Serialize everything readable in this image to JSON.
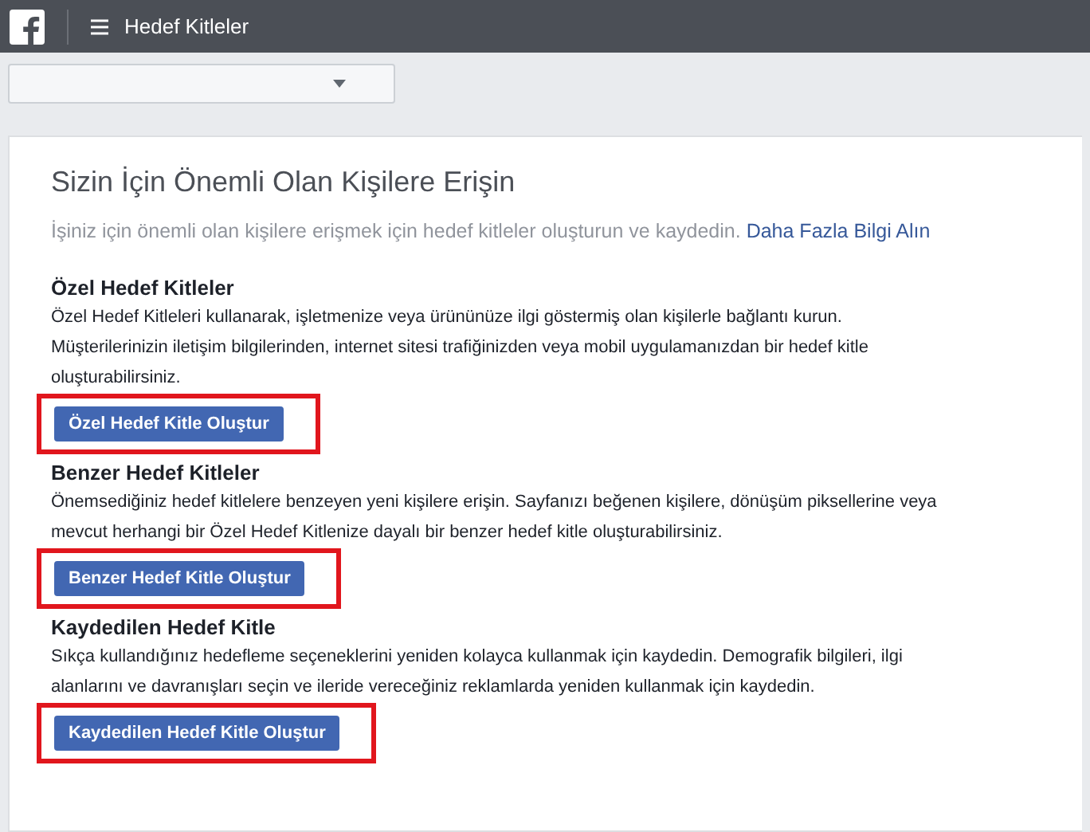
{
  "top_bar": {
    "title": "Hedef Kitleler"
  },
  "account_selector": {
    "expanded": false
  },
  "intro": {
    "heading": "Sizin İçin Önemli Olan Kişilere Erişin",
    "text": "İşiniz için önemli olan kişilere erişmek için hedef kitleler oluşturun ve kaydedin.",
    "link": "Daha Fazla Bilgi Alın"
  },
  "sections": [
    {
      "title": "Özel Hedef Kitleler",
      "description": "Özel Hedef Kitleleri kullanarak, işletmenize veya ürününüze ilgi göstermiş olan kişilerle bağlantı kurun. Müşterilerinizin iletişim bilgilerinden, internet sitesi trafiğinizden veya mobil uygulamanızdan bir hedef kitle oluşturabilirsiniz.",
      "button": "Özel Hedef Kitle Oluştur",
      "highlighted": true
    },
    {
      "title": "Benzer Hedef Kitleler",
      "description": "Önemsediğiniz hedef kitlelere benzeyen yeni kişilere erişin. Sayfanızı beğenen kişilere, dönüşüm piksellerine veya mevcut herhangi bir Özel Hedef Kitlenize dayalı bir benzer hedef kitle oluşturabilirsiniz.",
      "button": "Benzer Hedef Kitle Oluştur",
      "highlighted": true
    },
    {
      "title": "Kaydedilen Hedef Kitle",
      "description": "Sıkça kullandığınız hedefleme seçeneklerini yeniden kolayca kullanmak için kaydedin. Demografik bilgileri, ilgi alanlarını ve davranışları seçin ve ileride vereceğiniz reklamlarda yeniden kullanmak için kaydedin.",
      "button": "Kaydedilen Hedef Kitle Oluştur",
      "highlighted": true
    }
  ]
}
